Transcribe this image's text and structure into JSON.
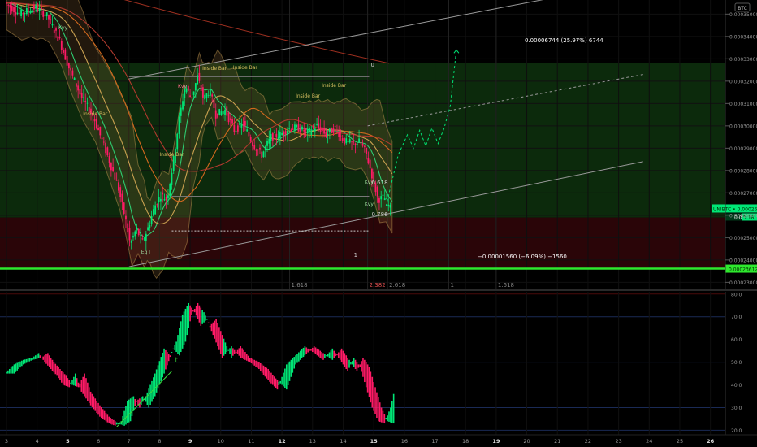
{
  "chart_data": [
    {
      "type": "candlestick",
      "panel": "price",
      "symbol_badge": "BTC",
      "y_ticks": [
        "0.00023000",
        "0.00024000",
        "0.00025000",
        "0.00026000",
        "0.00027000",
        "0.00028000",
        "0.00029000",
        "0.00030000",
        "0.00031000",
        "0.00032000",
        "0.00033000",
        "0.00034000",
        "0.00035000"
      ],
      "ylim": [
        0.0002265,
        0.0003563
      ],
      "x_ticks": [
        {
          "day": 3,
          "label": "3",
          "bold": false
        },
        {
          "day": 4,
          "label": "4",
          "bold": false
        },
        {
          "day": 5,
          "label": "5",
          "bold": true
        },
        {
          "day": 6,
          "label": "6",
          "bold": false
        },
        {
          "day": 7,
          "label": "7",
          "bold": false
        },
        {
          "day": 8,
          "label": "8",
          "bold": false
        },
        {
          "day": 9,
          "label": "9",
          "bold": true
        },
        {
          "day": 10,
          "label": "10",
          "bold": false
        },
        {
          "day": 11,
          "label": "11",
          "bold": false
        },
        {
          "day": 12,
          "label": "12",
          "bold": true
        },
        {
          "day": 13,
          "label": "13",
          "bold": false
        },
        {
          "day": 14,
          "label": "14",
          "bold": false
        },
        {
          "day": 15,
          "label": "15",
          "bold": true
        },
        {
          "day": 16,
          "label": "16",
          "bold": false
        },
        {
          "day": 17,
          "label": "17",
          "bold": false
        },
        {
          "day": 18,
          "label": "18",
          "bold": false
        },
        {
          "day": 19,
          "label": "19",
          "bold": true
        },
        {
          "day": 20,
          "label": "20",
          "bold": false
        },
        {
          "day": 21,
          "label": "21",
          "bold": false
        },
        {
          "day": 22,
          "label": "22",
          "bold": false
        },
        {
          "day": 23,
          "label": "23",
          "bold": false
        },
        {
          "day": 24,
          "label": "24",
          "bold": false
        },
        {
          "day": 25,
          "label": "25",
          "bold": false
        },
        {
          "day": 26,
          "label": "26",
          "bold": true
        }
      ],
      "price_path": [
        [
          3.0,
          0.000355
        ],
        [
          3.5,
          0.00035
        ],
        [
          4.0,
          0.000353
        ],
        [
          4.4,
          0.000349
        ],
        [
          4.8,
          0.000338
        ],
        [
          5.1,
          0.000326
        ],
        [
          5.5,
          0.000313
        ],
        [
          5.9,
          0.000304
        ],
        [
          6.3,
          0.000289
        ],
        [
          6.7,
          0.000273
        ],
        [
          6.95,
          0.000258
        ],
        [
          7.1,
          0.000247
        ],
        [
          7.3,
          0.000254
        ],
        [
          7.5,
          0.000248
        ],
        [
          7.7,
          0.000255
        ],
        [
          7.9,
          0.000264
        ],
        [
          8.1,
          0.000269
        ],
        [
          8.3,
          0.000267
        ],
        [
          8.5,
          0.000283
        ],
        [
          8.7,
          0.000303
        ],
        [
          8.9,
          0.000318
        ],
        [
          9.1,
          0.000312
        ],
        [
          9.3,
          0.000322
        ],
        [
          9.5,
          0.000312
        ],
        [
          9.7,
          0.000316
        ],
        [
          9.9,
          0.000305
        ],
        [
          10.2,
          0.000307
        ],
        [
          10.5,
          0.000298
        ],
        [
          10.8,
          0.000301
        ],
        [
          11.1,
          0.000292
        ],
        [
          11.4,
          0.000287
        ],
        [
          11.7,
          0.000295
        ],
        [
          12.0,
          0.000296
        ],
        [
          12.3,
          0.000299
        ],
        [
          12.6,
          0.000299
        ],
        [
          12.9,
          0.000297
        ],
        [
          13.2,
          0.0003
        ],
        [
          13.5,
          0.000296
        ],
        [
          13.8,
          0.000299
        ],
        [
          14.1,
          0.000293
        ],
        [
          14.4,
          0.000292
        ],
        [
          14.6,
          0.000293
        ],
        [
          14.8,
          0.000288
        ],
        [
          15.0,
          0.000278
        ],
        [
          15.2,
          0.000267
        ],
        [
          15.4,
          0.000268
        ],
        [
          15.6,
          0.000263
        ]
      ],
      "current_price_label": "UNIBTC • 0.00026305",
      "current_price_value": "0.00026305",
      "sub_price_label": "0.00026",
      "sub_price_tag": "5:18",
      "support_level_label": "0.00023612",
      "projection_up": {
        "label": "0.00006744 (25.97%) 6744",
        "percent": 25.97,
        "value": 6.744e-05,
        "ticks": 6744
      },
      "projection_down": {
        "label": "−0.00001560 (−6.09%) −1560",
        "percent": -6.09,
        "value": -1.56e-05,
        "ticks": -1560
      },
      "fib_labels": {
        "zero": "0",
        "one": "1",
        "level_0618": "0.618",
        "level_0786": "0.786",
        "time_1618_a": "1.618",
        "time_2382": "2.382",
        "time_2618": "2.618",
        "time_1": "1",
        "time_1618_b": "1.618"
      },
      "annotations": {
        "kvs_1": "Kvy",
        "kvs_2": "Kvy",
        "kvs_3": "Kvy",
        "kvs_4": "Kvy",
        "inside_bar_1": "Inside Bar",
        "inside_bar_2": "Inside Bar",
        "inside_bar_3": "Inside Bar",
        "inside_bar_4": "Inside Bar",
        "inside_bar_5": "Inside Bar",
        "inside_bar_6": "Inside Bar",
        "eq_low": "Eq l"
      },
      "colors": {
        "up": "#00e676",
        "down": "#ff1a66",
        "support_line": "#2ee82e",
        "green_zone": "#0c2a0c",
        "red_zone": "#2a0508"
      }
    },
    {
      "type": "oscillator",
      "panel": "indicator",
      "y_ticks": [
        "20.0",
        "30.0",
        "40.0",
        "50.0",
        "60.0",
        "70.0",
        "80.0"
      ],
      "ylim": [
        18,
        81
      ],
      "reference_levels": [
        30,
        50,
        70
      ],
      "values_path": [
        [
          3.0,
          45
        ],
        [
          3.3,
          49
        ],
        [
          3.6,
          51
        ],
        [
          3.9,
          52
        ],
        [
          4.1,
          54
        ],
        [
          4.3,
          50
        ],
        [
          4.5,
          47
        ],
        [
          4.7,
          44
        ],
        [
          4.9,
          40
        ],
        [
          5.1,
          39
        ],
        [
          5.3,
          45
        ],
        [
          5.5,
          37
        ],
        [
          5.8,
          31
        ],
        [
          6.1,
          26
        ],
        [
          6.4,
          23
        ],
        [
          6.6,
          22
        ],
        [
          6.8,
          24
        ],
        [
          7.0,
          33
        ],
        [
          7.2,
          35
        ],
        [
          7.4,
          30
        ],
        [
          7.6,
          35
        ],
        [
          7.9,
          45
        ],
        [
          8.2,
          56
        ],
        [
          8.4,
          53
        ],
        [
          8.6,
          59
        ],
        [
          8.8,
          71
        ],
        [
          9.0,
          76
        ],
        [
          9.2,
          72
        ],
        [
          9.4,
          66
        ],
        [
          9.6,
          69
        ],
        [
          9.8,
          62
        ],
        [
          10.1,
          52
        ],
        [
          10.4,
          57
        ],
        [
          10.7,
          52
        ],
        [
          11.0,
          50
        ],
        [
          11.3,
          47
        ],
        [
          11.6,
          42
        ],
        [
          11.9,
          38
        ],
        [
          12.2,
          49
        ],
        [
          12.5,
          53
        ],
        [
          12.8,
          57
        ],
        [
          13.1,
          54
        ],
        [
          13.4,
          51
        ],
        [
          13.7,
          56
        ],
        [
          14.0,
          50
        ],
        [
          14.2,
          46
        ],
        [
          14.4,
          52
        ],
        [
          14.6,
          48
        ],
        [
          14.8,
          39
        ],
        [
          15.0,
          30
        ],
        [
          15.2,
          24
        ],
        [
          15.4,
          23
        ],
        [
          15.6,
          30
        ],
        [
          15.7,
          36
        ]
      ],
      "annotation_arrow": "↑",
      "colors": {
        "up": "#00e676",
        "down": "#ff1a66"
      }
    }
  ]
}
